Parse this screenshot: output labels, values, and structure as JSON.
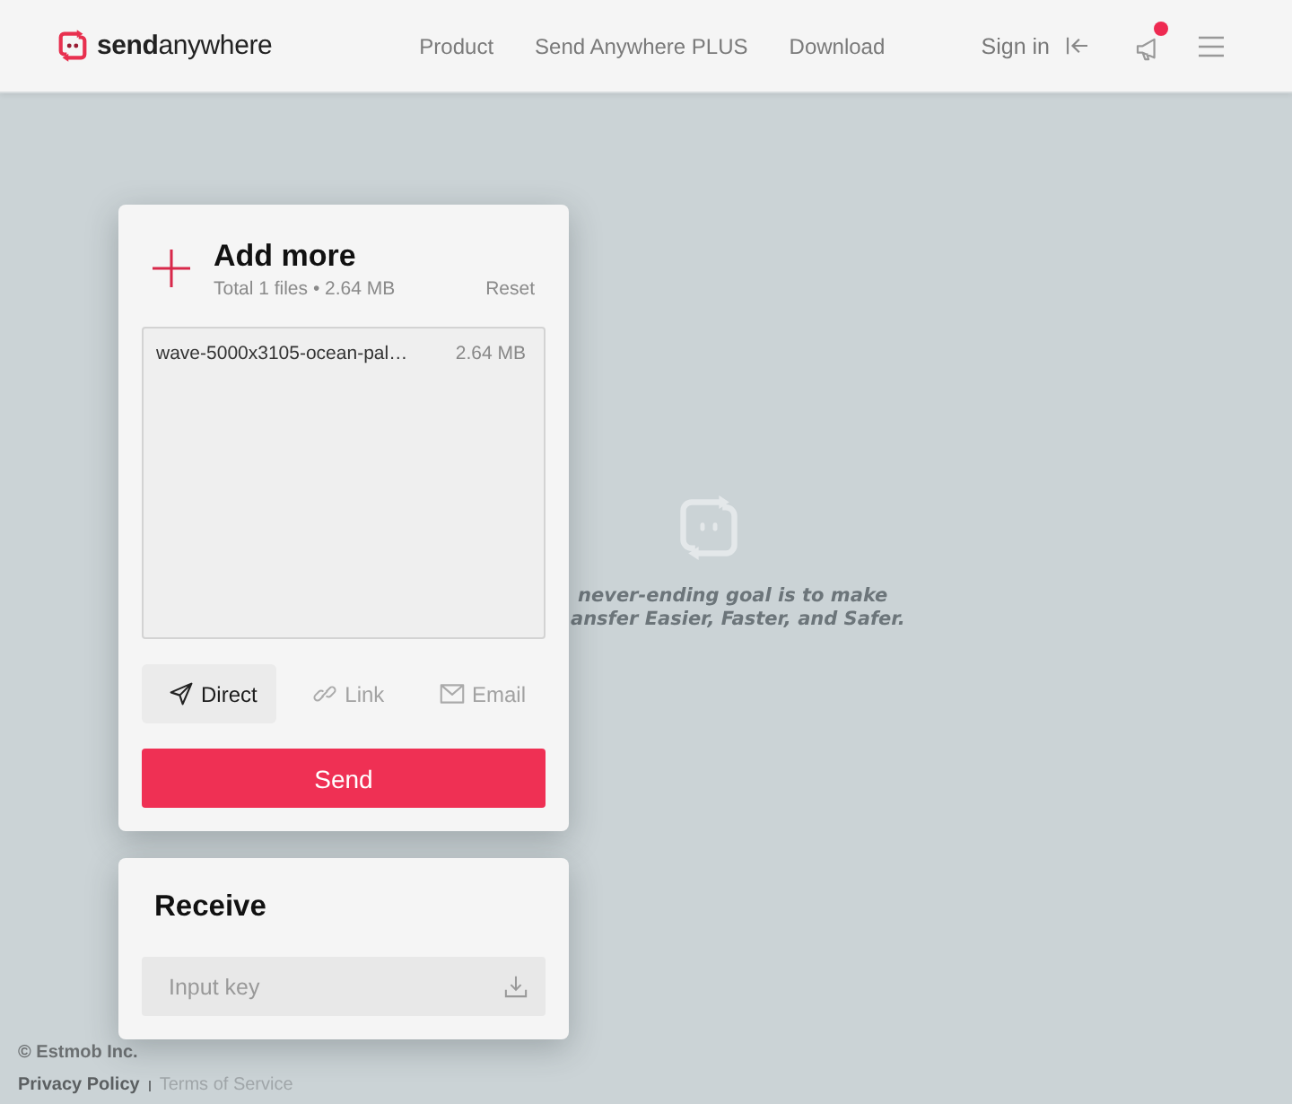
{
  "header": {
    "logo": "**send**anywhere",
    "nav": [
      {
        "label": "Product"
      },
      {
        "label": "Send Anywhere PLUS"
      },
      {
        "label": "Download"
      }
    ],
    "sign_in": "Sign in",
    "unread_notice": true
  },
  "hero": {
    "lines": [
      "never-ending goal is to make",
      "ansfer Easier, Faster, and Safer."
    ]
  },
  "send_card": {
    "title": "Add more",
    "summary": "Total 1 files • 2.64 MB",
    "reset": "Reset",
    "files": [
      {
        "name": "wave-5000x3105-ocean-pal…",
        "size": "2.64 MB"
      }
    ],
    "modes": [
      {
        "kind": "direct",
        "label": "Direct",
        "selected": true
      },
      {
        "kind": "link",
        "label": "Link",
        "selected": false
      },
      {
        "kind": "email",
        "label": "Email",
        "selected": false
      }
    ],
    "send_button": "Send"
  },
  "receive_card": {
    "title": "Receive",
    "input": {
      "placeholder": "Input key"
    }
  },
  "footer": {
    "copyright": "© Estmob Inc.",
    "links": [
      {
        "label": "Privacy Policy",
        "kind": "primary"
      },
      {
        "label": "Terms of Service",
        "kind": "secondary"
      }
    ]
  }
}
